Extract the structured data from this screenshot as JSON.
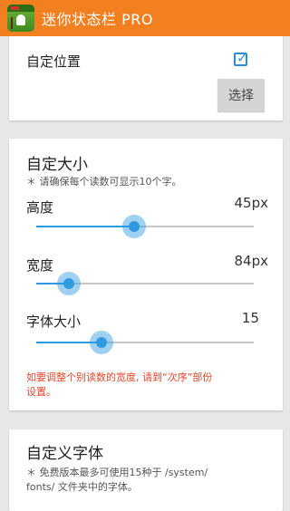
{
  "appbar": {
    "title": "迷你状态栏 PRO"
  },
  "position_card": {
    "label": "自定位置",
    "checked": true,
    "select_button": "选择"
  },
  "size_card": {
    "title": "自定大小",
    "hint": "＊ 请确保每个读数可显示10个字。",
    "sliders": [
      {
        "label": "高度",
        "value": "45px",
        "fraction": 0.45
      },
      {
        "label": "宽度",
        "value": "84px",
        "fraction": 0.15
      },
      {
        "label": "字体大小",
        "value": "15",
        "fraction": 0.3
      }
    ],
    "warning_line1": "如要调整个别读数的宽度, 请到“次序”部份",
    "warning_line2": "设置。"
  },
  "font_card": {
    "title": "自定义字体",
    "hint_line1": "＊ 免费版本最多可使用15种于 /system/",
    "hint_line2": "fonts/ 文件夹中的字体。"
  },
  "colors": {
    "appbar": "#f28020",
    "accent": "#2e9ae0",
    "warning": "#e8462a"
  }
}
